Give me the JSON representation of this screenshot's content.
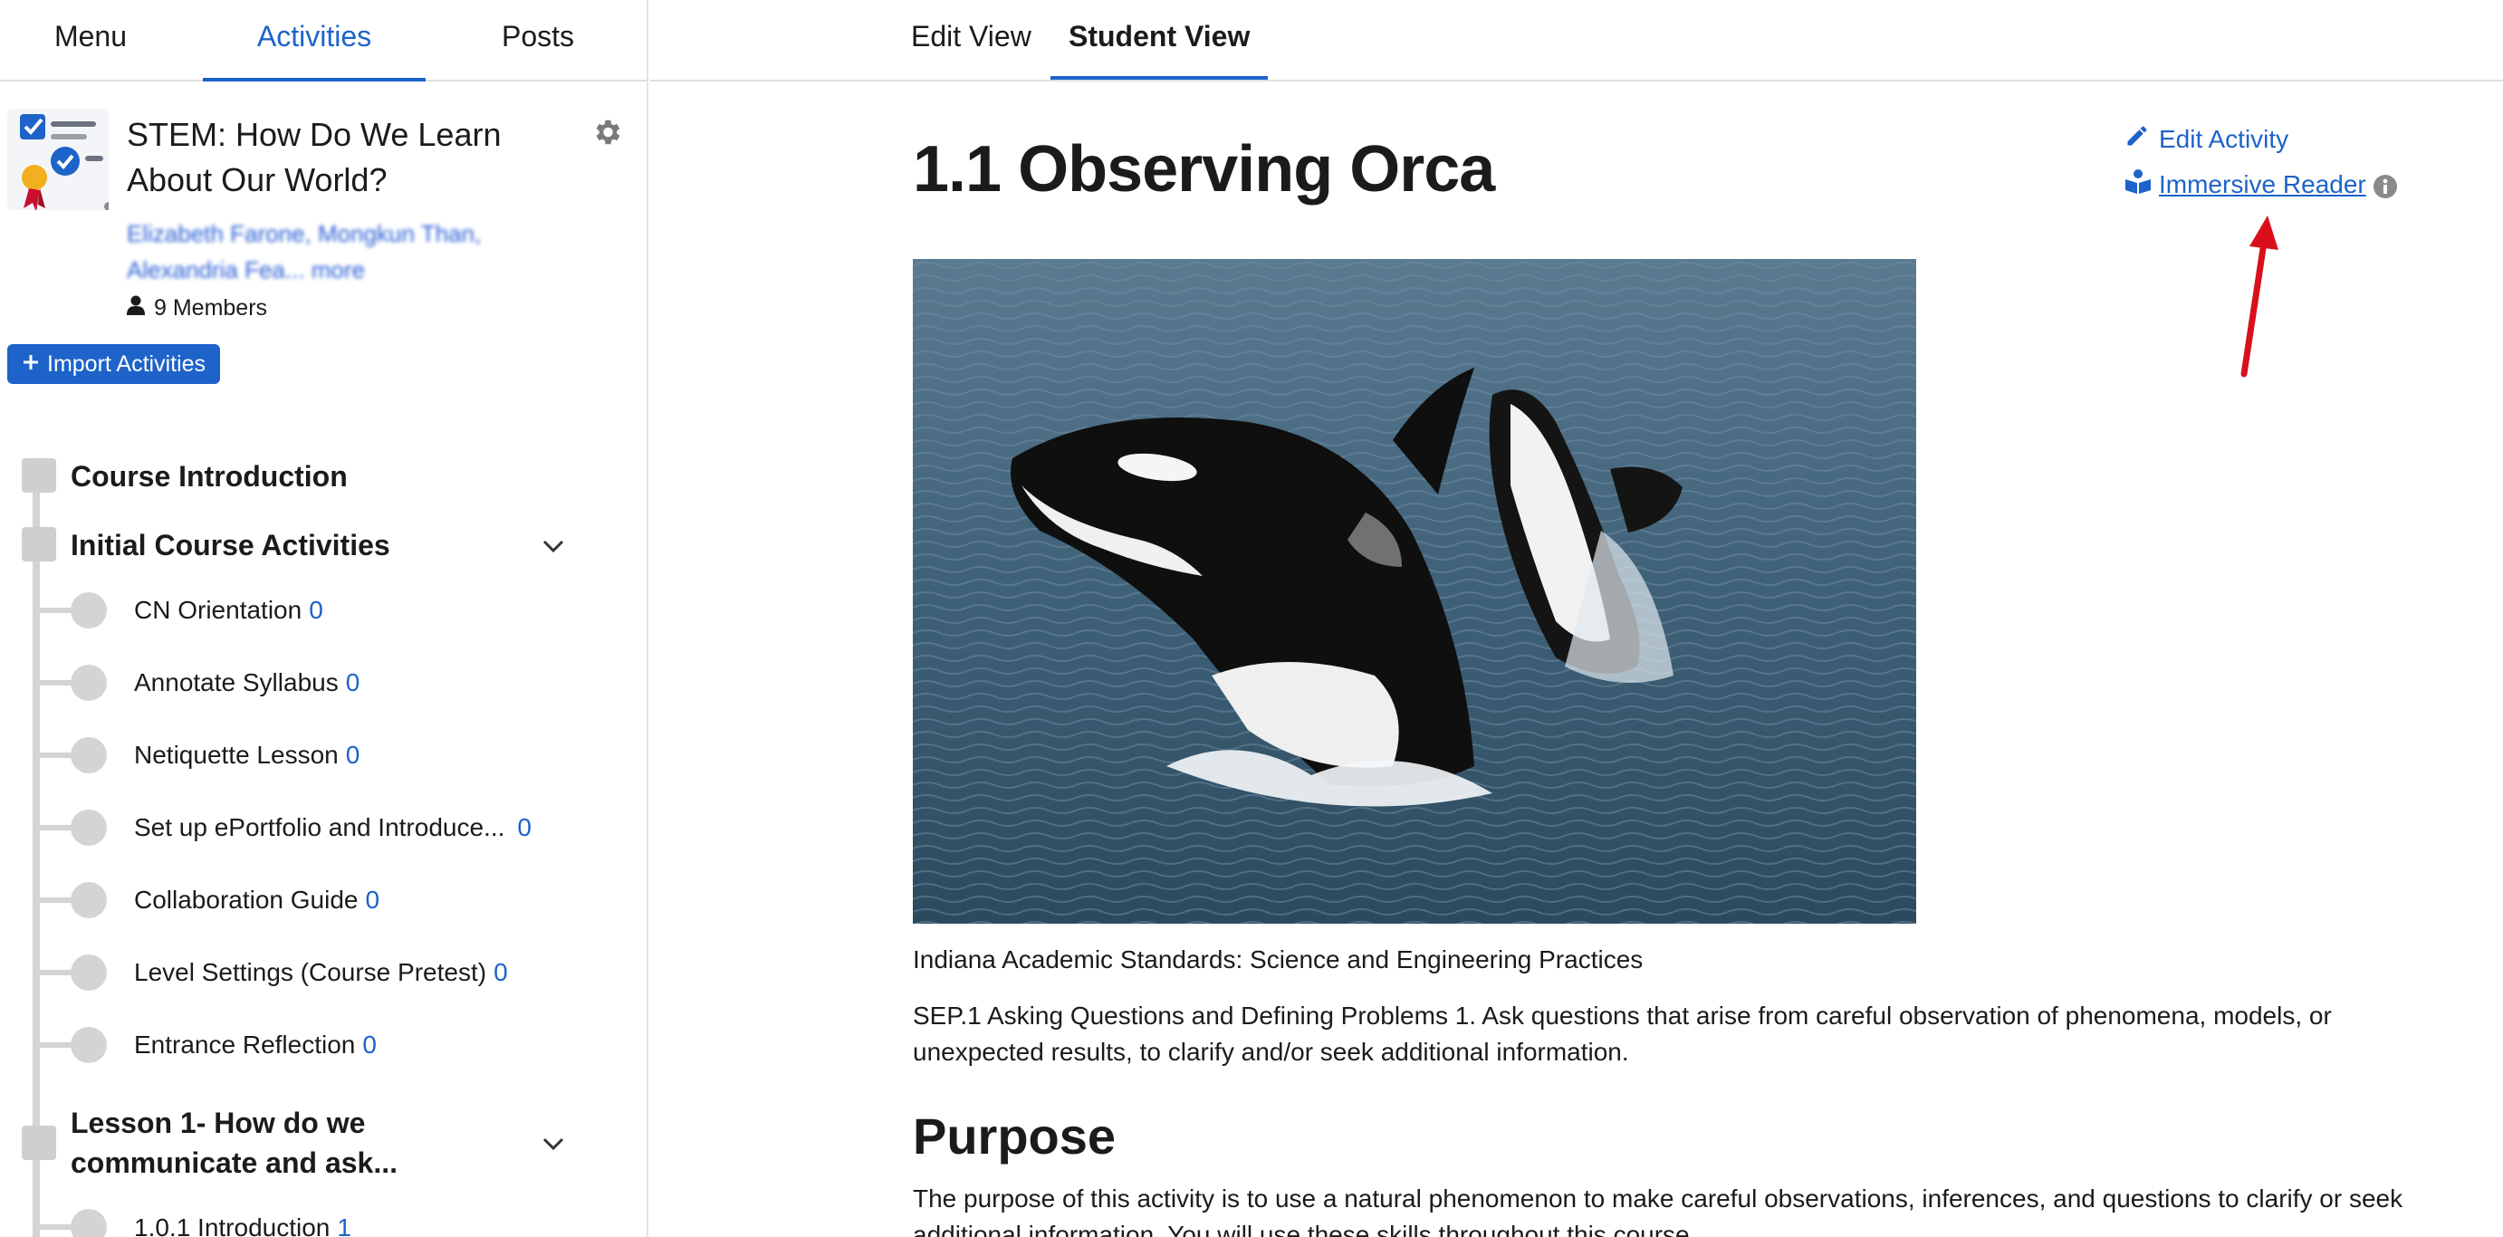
{
  "sidebar": {
    "tabs": [
      "Menu",
      "Activities",
      "Posts"
    ],
    "course_title": "STEM: How Do We Learn About Our World?",
    "authors": "Elizabeth Farone, Mongkun Than, Alexandria Fea... more",
    "members": "9 Members",
    "import_button": "Import Activities",
    "sections": [
      {
        "title": "Course Introduction"
      },
      {
        "title": "Initial Course Activities"
      },
      {
        "title": "Lesson 1- How do we communicate and ask..."
      }
    ],
    "items": [
      {
        "label": "CN Orientation",
        "count": "0"
      },
      {
        "label": "Annotate Syllabus",
        "count": "0"
      },
      {
        "label": "Netiquette Lesson",
        "count": "0"
      },
      {
        "label": "Set up ePortfolio and Introduce...",
        "count": "0"
      },
      {
        "label": "Collaboration Guide",
        "count": "0"
      },
      {
        "label": "Level Settings (Course Pretest)",
        "count": "0"
      },
      {
        "label": "Entrance Reflection",
        "count": "0"
      },
      {
        "label": "1.0.1 Introduction",
        "count": "1"
      }
    ]
  },
  "main": {
    "tabs": [
      "Edit View",
      "Student View"
    ],
    "title": "1.1 Observing Orca",
    "edit_activity": "Edit Activity",
    "immersive_reader": "Immersive Reader",
    "standards": "Indiana Academic Standards: Science and Engineering Practices",
    "sep_text": "SEP.1 Asking Questions and Defining Problems 1. Ask questions that arise from careful observation of phenomena, models, or unexpected results, to clarify and/or seek additional information.",
    "purpose_heading": "Purpose",
    "purpose_text": "The purpose of this activity is to use a natural phenomenon to make careful observations, inferences, and questions to clarify or seek additional information. You will use these skills throughout this course."
  },
  "colors": {
    "accent": "#1d63c9",
    "annotation_arrow": "#d9101c",
    "tree_gray": "#d4d4d4"
  },
  "icons": [
    "course-thumbnail-icon",
    "gear-icon",
    "person-icon",
    "plus-icon",
    "chevron-down-icon",
    "pencil-icon",
    "book-reader-icon",
    "info-icon"
  ]
}
